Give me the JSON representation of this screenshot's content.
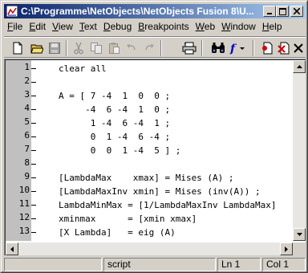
{
  "window": {
    "title": "C:\\Programme\\NetObjects\\NetObjects Fusion 8\\U..."
  },
  "caption_buttons": {
    "minimize_icon": "minimize-icon",
    "maximize_icon": "maximize-icon",
    "close_icon": "close-icon"
  },
  "menu": {
    "items": [
      {
        "label": "File",
        "underline": "F",
        "rest": "ile"
      },
      {
        "label": "Edit",
        "underline": "E",
        "rest": "dit"
      },
      {
        "label": "View",
        "underline": "V",
        "rest": "iew"
      },
      {
        "label": "Text",
        "underline": "T",
        "rest": "ext"
      },
      {
        "label": "Debug",
        "underline": "D",
        "rest": "ebug"
      },
      {
        "label": "Breakpoints",
        "underline": "B",
        "rest": "reakpoints"
      },
      {
        "label": "Web",
        "underline": "W",
        "rest": "eb"
      },
      {
        "label": "Window",
        "underline": "W",
        "rest": "indow"
      },
      {
        "label": "Help",
        "underline": "H",
        "rest": "elp"
      }
    ]
  },
  "toolbar": {
    "icons": [
      "new-document-icon",
      "open-folder-icon",
      "save-icon",
      "cut-icon",
      "copy-icon",
      "paste-icon",
      "undo-icon",
      "redo-icon",
      "print-icon",
      "find-icon",
      "function-icon",
      "set-breakpoint-icon",
      "clear-breakpoint-icon",
      "close-x-icon"
    ]
  },
  "editor": {
    "lines": [
      {
        "number": "1",
        "text": "clear all"
      },
      {
        "number": "2",
        "text": ""
      },
      {
        "number": "3",
        "text": "A = [ 7 -4  1  0  0 ;"
      },
      {
        "number": "4",
        "text": "     -4  6 -4  1  0 ;"
      },
      {
        "number": "5",
        "text": "      1 -4  6 -4  1 ;"
      },
      {
        "number": "6",
        "text": "      0  1 -4  6 -4 ;"
      },
      {
        "number": "7",
        "text": "      0  0  1 -4  5 ] ;"
      },
      {
        "number": "8",
        "text": ""
      },
      {
        "number": "9",
        "text": "[LambdaMax    xmax] = Mises (A) ;"
      },
      {
        "number": "10",
        "text": "[LambdaMaxInv xmin] = Mises (inv(A)) ;"
      },
      {
        "number": "11",
        "text": "LambdaMinMax = [1/LambdaMaxInv LambdaMax]"
      },
      {
        "number": "12",
        "text": "xminmax      = [xmin xmax]"
      },
      {
        "number": "13",
        "text": "[X Lambda]   = eig (A)"
      }
    ]
  },
  "status": {
    "mode": "script",
    "line": "Ln 1",
    "column": "Col 1"
  }
}
